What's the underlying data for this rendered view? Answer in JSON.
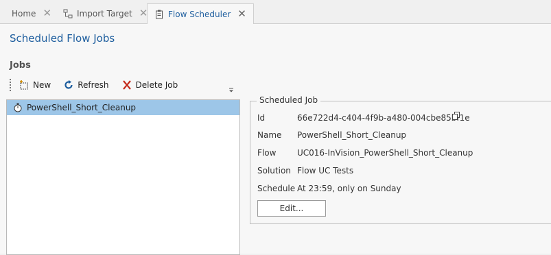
{
  "tabs": [
    {
      "label": "Home",
      "icon": "none"
    },
    {
      "label": "Import Target",
      "icon": "import-target-icon"
    },
    {
      "label": "Flow Scheduler",
      "icon": "scheduler-icon"
    }
  ],
  "page": {
    "title": "Scheduled Flow Jobs"
  },
  "jobs": {
    "heading": "Jobs",
    "toolbar": {
      "new_label": "New",
      "refresh_label": "Refresh",
      "delete_label": "Delete Job"
    },
    "items": [
      {
        "name": "PowerShell_Short_Cleanup",
        "selected": true
      }
    ]
  },
  "details": {
    "group_title": "Scheduled Job",
    "fields": [
      {
        "label": "Id",
        "value": "66e722d4-c404-4f9b-a480-004cbe85bf1e"
      },
      {
        "label": "Name",
        "value": "PowerShell_Short_Cleanup"
      },
      {
        "label": "Flow",
        "value": "UC016-InVision_PowerShell_Short_Cleanup"
      },
      {
        "label": "Solution",
        "value": "Flow UC Tests"
      },
      {
        "label": "Schedule",
        "value": "At 23:59, only on Sunday"
      }
    ],
    "edit_label": "Edit..."
  },
  "colors": {
    "accent": "#1e5e9e",
    "selection": "#9dc6e8",
    "delete": "#c42b1c",
    "refresh": "#1e5e9e"
  }
}
